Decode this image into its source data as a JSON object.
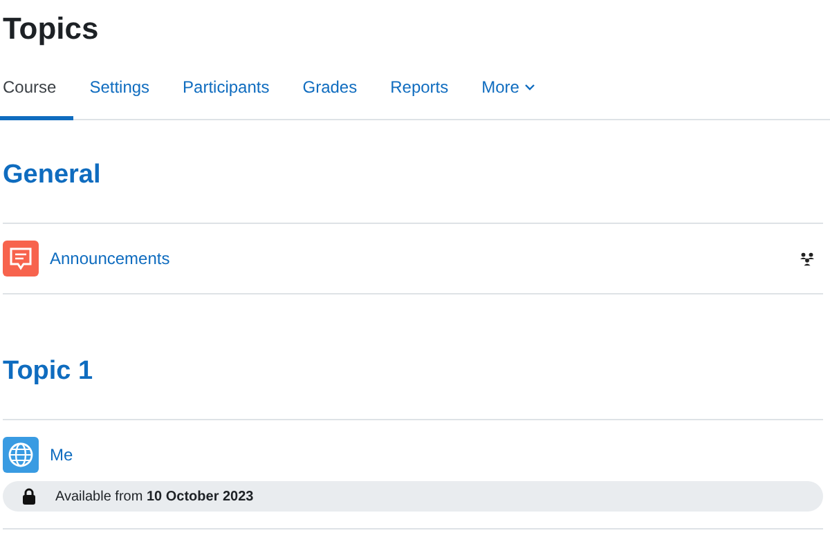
{
  "title": "Topics",
  "tabs": [
    {
      "label": "Course",
      "selected": true
    },
    {
      "label": "Settings",
      "selected": false
    },
    {
      "label": "Participants",
      "selected": false
    },
    {
      "label": "Grades",
      "selected": false
    },
    {
      "label": "Reports",
      "selected": false
    },
    {
      "label": "More",
      "selected": false,
      "kind": "menu"
    }
  ],
  "sections": [
    {
      "title": "General",
      "activities": [
        {
          "kind": "forum",
          "name": "Announcements",
          "group_mode": true
        }
      ]
    },
    {
      "title": "Topic 1",
      "activities": [
        {
          "kind": "url",
          "name": "Me",
          "restriction": "Available from **10 October 2023**"
        }
      ]
    }
  ]
}
